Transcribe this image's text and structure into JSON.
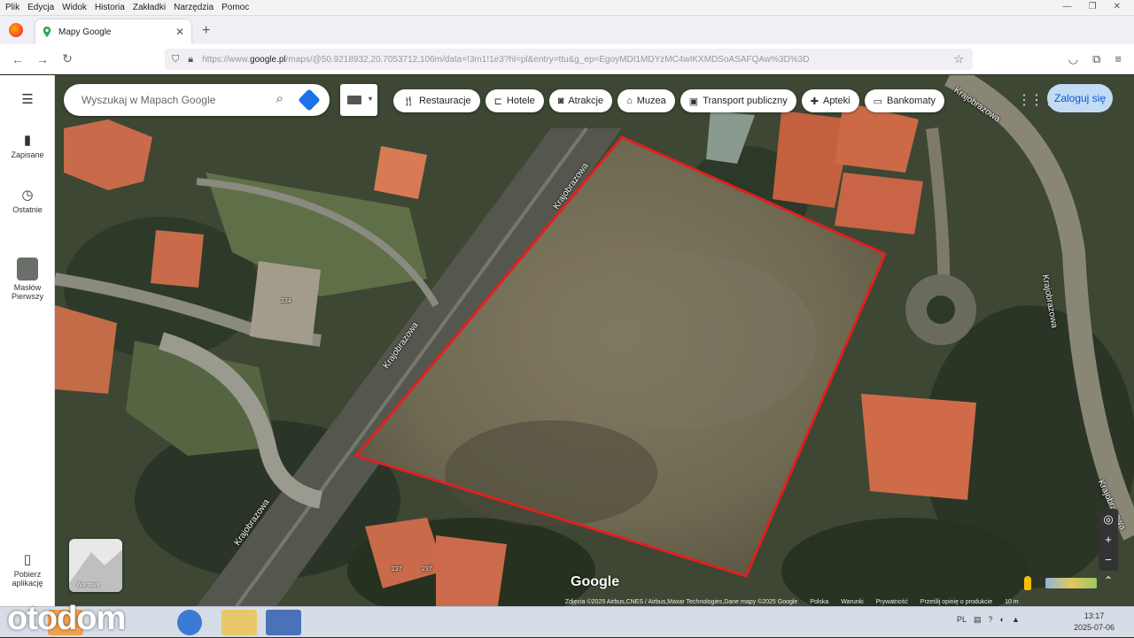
{
  "menubar": [
    "Plik",
    "Edycja",
    "Widok",
    "Historia",
    "Zakładki",
    "Narzędzia",
    "Pomoc"
  ],
  "tab": {
    "title": "Mapy Google"
  },
  "url": {
    "prefix": "https://www.",
    "host": "google.pl",
    "rest": "/maps/@50.9218932,20.7053712,106m/data=!3m1!1e3?hl=pl&entry=ttu&g_ep=EgoyMDI1MDYzMC4wIKXMDSoASAFQAw%3D%3D"
  },
  "sidebar": {
    "saved": "Zapisane",
    "recent": "Ostatnie",
    "place": "Masłów Pierwszy",
    "download": "Pobierz aplikację"
  },
  "search": {
    "placeholder": "Wyszukaj w Mapach Google"
  },
  "chips": [
    {
      "label": "Restauracje",
      "icon": "fork-knife-icon"
    },
    {
      "label": "Hotele",
      "icon": "bed-icon"
    },
    {
      "label": "Atrakcje",
      "icon": "camera-icon"
    },
    {
      "label": "Muzea",
      "icon": "museum-icon"
    },
    {
      "label": "Transport publiczny",
      "icon": "bus-icon"
    },
    {
      "label": "Apteki",
      "icon": "pharmacy-icon"
    },
    {
      "label": "Bankomaty",
      "icon": "atm-icon"
    }
  ],
  "login": "Zaloguj się",
  "streets": {
    "s1": "Krajobrazowa",
    "s2": "Krajobrazowa",
    "s3": "Krajobrazowa",
    "s4": "Krajobrazowa",
    "s5": "Krajobrazowa",
    "s6": "Krajobrazowa"
  },
  "house_numbers": {
    "h1": "234",
    "h2": "237",
    "h3": "237"
  },
  "map": {
    "logo": "Google",
    "layers_label": "Warstwy",
    "attribution": "Zdjęcia ©2025 Airbus,CNES / Airbus,Maxar Technologies,Dane mapy ©2025 Google",
    "links": [
      "Polska",
      "Warunki",
      "Prywatność",
      "Prześlij opinię o produkcie",
      "10 m"
    ]
  },
  "taskbar": {
    "brand": "otodom",
    "lang": "PL",
    "time": "13:17",
    "date": "2025-07-06"
  },
  "colors": {
    "plot_outline": "#e02020",
    "accent": "#1a73e8"
  }
}
